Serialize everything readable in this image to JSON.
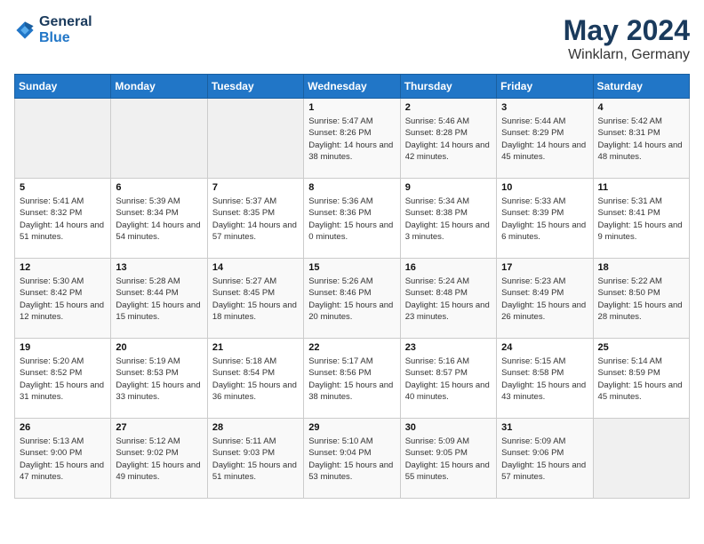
{
  "header": {
    "logo_line1": "General",
    "logo_line2": "Blue",
    "month": "May 2024",
    "location": "Winklarn, Germany"
  },
  "weekdays": [
    "Sunday",
    "Monday",
    "Tuesday",
    "Wednesday",
    "Thursday",
    "Friday",
    "Saturday"
  ],
  "weeks": [
    [
      {
        "num": "",
        "sunrise": "",
        "sunset": "",
        "daylight": "",
        "empty": true
      },
      {
        "num": "",
        "sunrise": "",
        "sunset": "",
        "daylight": "",
        "empty": true
      },
      {
        "num": "",
        "sunrise": "",
        "sunset": "",
        "daylight": "",
        "empty": true
      },
      {
        "num": "1",
        "sunrise": "Sunrise: 5:47 AM",
        "sunset": "Sunset: 8:26 PM",
        "daylight": "Daylight: 14 hours and 38 minutes."
      },
      {
        "num": "2",
        "sunrise": "Sunrise: 5:46 AM",
        "sunset": "Sunset: 8:28 PM",
        "daylight": "Daylight: 14 hours and 42 minutes."
      },
      {
        "num": "3",
        "sunrise": "Sunrise: 5:44 AM",
        "sunset": "Sunset: 8:29 PM",
        "daylight": "Daylight: 14 hours and 45 minutes."
      },
      {
        "num": "4",
        "sunrise": "Sunrise: 5:42 AM",
        "sunset": "Sunset: 8:31 PM",
        "daylight": "Daylight: 14 hours and 48 minutes."
      }
    ],
    [
      {
        "num": "5",
        "sunrise": "Sunrise: 5:41 AM",
        "sunset": "Sunset: 8:32 PM",
        "daylight": "Daylight: 14 hours and 51 minutes."
      },
      {
        "num": "6",
        "sunrise": "Sunrise: 5:39 AM",
        "sunset": "Sunset: 8:34 PM",
        "daylight": "Daylight: 14 hours and 54 minutes."
      },
      {
        "num": "7",
        "sunrise": "Sunrise: 5:37 AM",
        "sunset": "Sunset: 8:35 PM",
        "daylight": "Daylight: 14 hours and 57 minutes."
      },
      {
        "num": "8",
        "sunrise": "Sunrise: 5:36 AM",
        "sunset": "Sunset: 8:36 PM",
        "daylight": "Daylight: 15 hours and 0 minutes."
      },
      {
        "num": "9",
        "sunrise": "Sunrise: 5:34 AM",
        "sunset": "Sunset: 8:38 PM",
        "daylight": "Daylight: 15 hours and 3 minutes."
      },
      {
        "num": "10",
        "sunrise": "Sunrise: 5:33 AM",
        "sunset": "Sunset: 8:39 PM",
        "daylight": "Daylight: 15 hours and 6 minutes."
      },
      {
        "num": "11",
        "sunrise": "Sunrise: 5:31 AM",
        "sunset": "Sunset: 8:41 PM",
        "daylight": "Daylight: 15 hours and 9 minutes."
      }
    ],
    [
      {
        "num": "12",
        "sunrise": "Sunrise: 5:30 AM",
        "sunset": "Sunset: 8:42 PM",
        "daylight": "Daylight: 15 hours and 12 minutes."
      },
      {
        "num": "13",
        "sunrise": "Sunrise: 5:28 AM",
        "sunset": "Sunset: 8:44 PM",
        "daylight": "Daylight: 15 hours and 15 minutes."
      },
      {
        "num": "14",
        "sunrise": "Sunrise: 5:27 AM",
        "sunset": "Sunset: 8:45 PM",
        "daylight": "Daylight: 15 hours and 18 minutes."
      },
      {
        "num": "15",
        "sunrise": "Sunrise: 5:26 AM",
        "sunset": "Sunset: 8:46 PM",
        "daylight": "Daylight: 15 hours and 20 minutes."
      },
      {
        "num": "16",
        "sunrise": "Sunrise: 5:24 AM",
        "sunset": "Sunset: 8:48 PM",
        "daylight": "Daylight: 15 hours and 23 minutes."
      },
      {
        "num": "17",
        "sunrise": "Sunrise: 5:23 AM",
        "sunset": "Sunset: 8:49 PM",
        "daylight": "Daylight: 15 hours and 26 minutes."
      },
      {
        "num": "18",
        "sunrise": "Sunrise: 5:22 AM",
        "sunset": "Sunset: 8:50 PM",
        "daylight": "Daylight: 15 hours and 28 minutes."
      }
    ],
    [
      {
        "num": "19",
        "sunrise": "Sunrise: 5:20 AM",
        "sunset": "Sunset: 8:52 PM",
        "daylight": "Daylight: 15 hours and 31 minutes."
      },
      {
        "num": "20",
        "sunrise": "Sunrise: 5:19 AM",
        "sunset": "Sunset: 8:53 PM",
        "daylight": "Daylight: 15 hours and 33 minutes."
      },
      {
        "num": "21",
        "sunrise": "Sunrise: 5:18 AM",
        "sunset": "Sunset: 8:54 PM",
        "daylight": "Daylight: 15 hours and 36 minutes."
      },
      {
        "num": "22",
        "sunrise": "Sunrise: 5:17 AM",
        "sunset": "Sunset: 8:56 PM",
        "daylight": "Daylight: 15 hours and 38 minutes."
      },
      {
        "num": "23",
        "sunrise": "Sunrise: 5:16 AM",
        "sunset": "Sunset: 8:57 PM",
        "daylight": "Daylight: 15 hours and 40 minutes."
      },
      {
        "num": "24",
        "sunrise": "Sunrise: 5:15 AM",
        "sunset": "Sunset: 8:58 PM",
        "daylight": "Daylight: 15 hours and 43 minutes."
      },
      {
        "num": "25",
        "sunrise": "Sunrise: 5:14 AM",
        "sunset": "Sunset: 8:59 PM",
        "daylight": "Daylight: 15 hours and 45 minutes."
      }
    ],
    [
      {
        "num": "26",
        "sunrise": "Sunrise: 5:13 AM",
        "sunset": "Sunset: 9:00 PM",
        "daylight": "Daylight: 15 hours and 47 minutes."
      },
      {
        "num": "27",
        "sunrise": "Sunrise: 5:12 AM",
        "sunset": "Sunset: 9:02 PM",
        "daylight": "Daylight: 15 hours and 49 minutes."
      },
      {
        "num": "28",
        "sunrise": "Sunrise: 5:11 AM",
        "sunset": "Sunset: 9:03 PM",
        "daylight": "Daylight: 15 hours and 51 minutes."
      },
      {
        "num": "29",
        "sunrise": "Sunrise: 5:10 AM",
        "sunset": "Sunset: 9:04 PM",
        "daylight": "Daylight: 15 hours and 53 minutes."
      },
      {
        "num": "30",
        "sunrise": "Sunrise: 5:09 AM",
        "sunset": "Sunset: 9:05 PM",
        "daylight": "Daylight: 15 hours and 55 minutes."
      },
      {
        "num": "31",
        "sunrise": "Sunrise: 5:09 AM",
        "sunset": "Sunset: 9:06 PM",
        "daylight": "Daylight: 15 hours and 57 minutes."
      },
      {
        "num": "",
        "sunrise": "",
        "sunset": "",
        "daylight": "",
        "empty": true
      }
    ]
  ]
}
